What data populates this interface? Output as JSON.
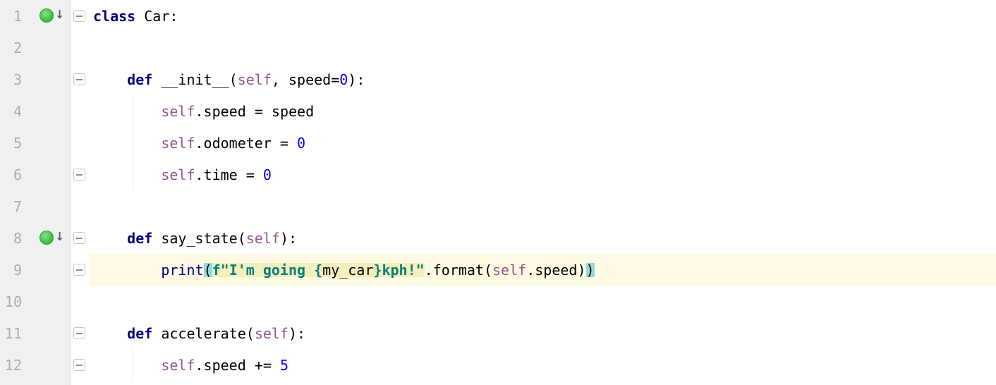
{
  "lines": {
    "1": "1",
    "2": "2",
    "3": "3",
    "4": "4",
    "5": "5",
    "6": "6",
    "7": "7",
    "8": "8",
    "9": "9",
    "10": "10",
    "11": "11",
    "12": "12"
  },
  "code": {
    "l1": {
      "kw": "class ",
      "name": "Car",
      "colon": ":"
    },
    "l3": {
      "kw": "def ",
      "name": "__init__",
      "lp": "(",
      "self": "self",
      "comma": ", ",
      "param": "speed",
      "eq": "=",
      "val": "0",
      "rp": ")",
      "colon": ":"
    },
    "l4": {
      "self": "self",
      "dot": ".",
      "attr": "speed",
      "sp": " ",
      "eq": "=",
      "sp2": " ",
      "val": "speed"
    },
    "l5": {
      "self": "self",
      "dot": ".",
      "attr": "odometer",
      "sp": " ",
      "eq": "=",
      "sp2": " ",
      "val": "0"
    },
    "l6": {
      "self": "self",
      "dot": ".",
      "attr": "time",
      "sp": " ",
      "eq": "=",
      "sp2": " ",
      "val": "0"
    },
    "l8": {
      "kw": "def ",
      "name": "say_state",
      "lp": "(",
      "self": "self",
      "rp": ")",
      "colon": ":"
    },
    "l9": {
      "print": "print",
      "lp": "(",
      "f": "f",
      "q1": "\"",
      "s1": "I'm going ",
      "lb": "{",
      "expr": "my_car",
      "rb": "}",
      "s2": "kph!",
      "q2": "\"",
      "dot": ".",
      "fmt": "format",
      "lp2": "(",
      "self": "self",
      "dot2": ".",
      "attr": "speed",
      "rp2": ")",
      "rp": ")"
    },
    "l11": {
      "kw": "def ",
      "name": "accelerate",
      "lp": "(",
      "self": "self",
      "rp": ")",
      "colon": ":"
    },
    "l12": {
      "self": "self",
      "dot": ".",
      "attr": "speed",
      "sp": " ",
      "op": "+=",
      "sp2": " ",
      "val": "5"
    }
  },
  "indent": {
    "i1": "    ",
    "i2": "        "
  }
}
